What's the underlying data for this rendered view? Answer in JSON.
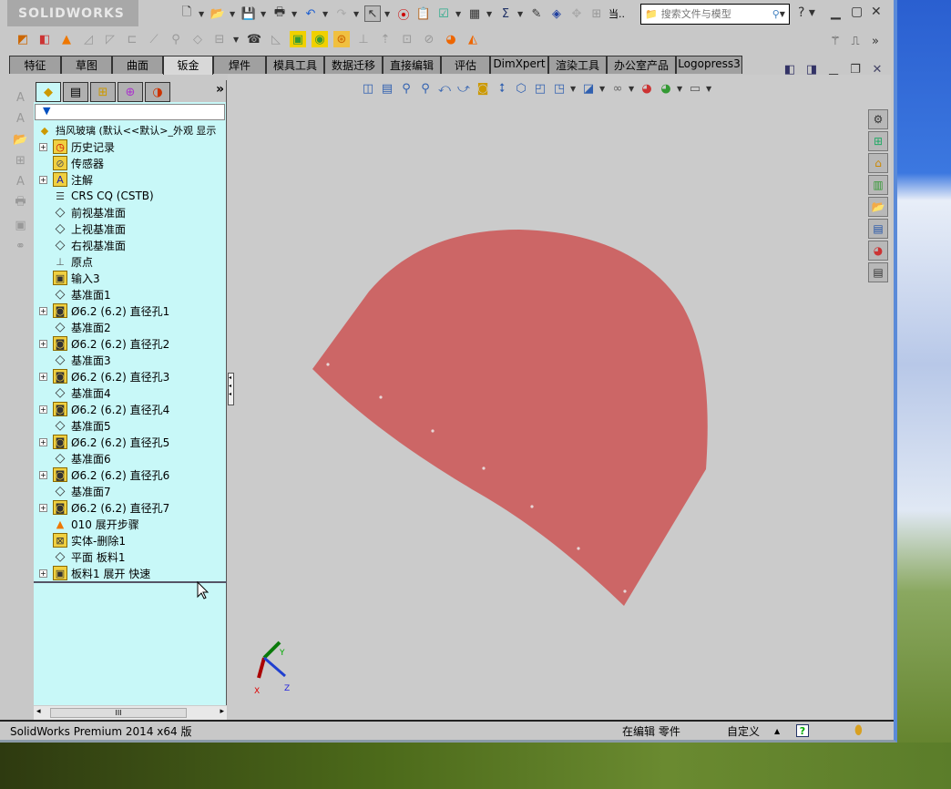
{
  "app": {
    "logo": "SOLIDWORKS",
    "title_overflow": "当.."
  },
  "search": {
    "placeholder": "搜索文件与模型"
  },
  "toolbar_icons": [
    "new-icon",
    "open-icon",
    "save-icon",
    "print-icon",
    "undo-icon",
    "redo-icon",
    "select-icon",
    "rebuild-icon",
    "file-properties-icon",
    "options-icon",
    "table-icon",
    "measure-icon",
    "pen-icon",
    "tape-icon",
    "move-icon",
    "align-icon"
  ],
  "tabs": [
    {
      "label": "特征"
    },
    {
      "label": "草图"
    },
    {
      "label": "曲面"
    },
    {
      "label": "钣金",
      "active": true
    },
    {
      "label": "焊件"
    },
    {
      "label": "模具工具"
    },
    {
      "label": "数据迁移"
    },
    {
      "label": "直接编辑"
    },
    {
      "label": "评估"
    },
    {
      "label": "DimXpert"
    },
    {
      "label": "渲染工具"
    },
    {
      "label": "办公室产品"
    },
    {
      "label": "Logopress3"
    }
  ],
  "panel": {
    "more": "»",
    "filter_icon": "filter-icon"
  },
  "tree": {
    "root": "挡风玻璃  (默认<<默认>_外观 显示",
    "items": [
      {
        "label": "历史记录",
        "exp": true,
        "icon": "history"
      },
      {
        "label": "传感器",
        "exp": false,
        "icon": "sensor"
      },
      {
        "label": "注解",
        "exp": true,
        "icon": "annotation"
      },
      {
        "label": "CRS CQ (CSTB)",
        "exp": false,
        "icon": "material"
      },
      {
        "label": "前视基准面",
        "exp": false,
        "icon": "plane"
      },
      {
        "label": "上视基准面",
        "exp": false,
        "icon": "plane"
      },
      {
        "label": "右视基准面",
        "exp": false,
        "icon": "plane"
      },
      {
        "label": "原点",
        "exp": false,
        "icon": "origin"
      },
      {
        "label": "输入3",
        "exp": false,
        "icon": "feature"
      },
      {
        "label": "基准面1",
        "exp": false,
        "icon": "plane"
      },
      {
        "label": "Ø6.2 (6.2) 直径孔1",
        "exp": true,
        "icon": "hole"
      },
      {
        "label": "基准面2",
        "exp": false,
        "icon": "plane"
      },
      {
        "label": "Ø6.2 (6.2) 直径孔2",
        "exp": true,
        "icon": "hole"
      },
      {
        "label": "基准面3",
        "exp": false,
        "icon": "plane"
      },
      {
        "label": "Ø6.2 (6.2) 直径孔3",
        "exp": true,
        "icon": "hole"
      },
      {
        "label": "基准面4",
        "exp": false,
        "icon": "plane"
      },
      {
        "label": "Ø6.2 (6.2) 直径孔4",
        "exp": true,
        "icon": "hole"
      },
      {
        "label": "基准面5",
        "exp": false,
        "icon": "plane"
      },
      {
        "label": "Ø6.2 (6.2) 直径孔5",
        "exp": true,
        "icon": "hole"
      },
      {
        "label": "基准面6",
        "exp": false,
        "icon": "plane"
      },
      {
        "label": "Ø6.2 (6.2) 直径孔6",
        "exp": true,
        "icon": "hole"
      },
      {
        "label": "基准面7",
        "exp": false,
        "icon": "plane"
      },
      {
        "label": "Ø6.2 (6.2) 直径孔7",
        "exp": true,
        "icon": "hole"
      },
      {
        "label": "010 展开步骤",
        "exp": false,
        "icon": "cone"
      },
      {
        "label": "实体-删除1",
        "exp": false,
        "icon": "delete-body"
      },
      {
        "label": "平面 板料1",
        "exp": false,
        "icon": "plane"
      },
      {
        "label": "板料1 展开 快速",
        "exp": true,
        "icon": "sheet"
      }
    ]
  },
  "scroll": {
    "thumb": "III"
  },
  "triad": {
    "x": "X",
    "y": "Y",
    "z": "Z"
  },
  "model": {
    "color": "#cc6666"
  },
  "status": {
    "version": "SolidWorks Premium 2014 x64 版",
    "mode": "在编辑 零件",
    "units": "自定义",
    "up": "▲",
    "help": "?"
  }
}
